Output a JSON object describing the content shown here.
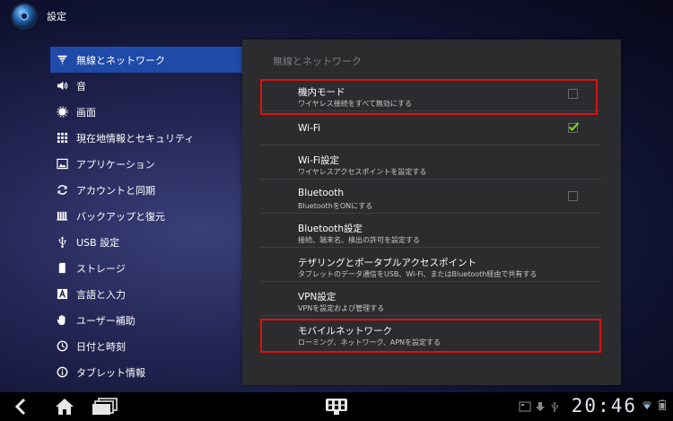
{
  "app": {
    "title": "設定"
  },
  "sidebar": {
    "items": [
      {
        "label": "無線とネットワーク",
        "icon": "wifi-icon",
        "selected": true
      },
      {
        "label": "音",
        "icon": "speaker-icon",
        "selected": false
      },
      {
        "label": "画面",
        "icon": "display-icon",
        "selected": false
      },
      {
        "label": "現在地情報とセキュリティ",
        "icon": "grid-icon",
        "selected": false
      },
      {
        "label": "アプリケーション",
        "icon": "image-icon",
        "selected": false
      },
      {
        "label": "アカウントと同期",
        "icon": "sync-icon",
        "selected": false
      },
      {
        "label": "バックアップと復元",
        "icon": "backup-icon",
        "selected": false
      },
      {
        "label": "USB 設定",
        "icon": "usb-icon",
        "selected": false
      },
      {
        "label": "ストレージ",
        "icon": "sd-card-icon",
        "selected": false
      },
      {
        "label": "言語と入力",
        "icon": "language-icon",
        "selected": false
      },
      {
        "label": "ユーザー補助",
        "icon": "hand-icon",
        "selected": false
      },
      {
        "label": "日付と時刻",
        "icon": "clock-icon",
        "selected": false
      },
      {
        "label": "タブレット情報",
        "icon": "info-icon",
        "selected": false
      }
    ]
  },
  "panel": {
    "header": "無線とネットワーク",
    "rows": [
      {
        "title": "機内モード",
        "summary": "ワイヤレス接続をすべて無効にする",
        "checkbox": "unchecked"
      },
      {
        "title": "Wi-Fi",
        "summary": "",
        "checkbox": "checked"
      },
      {
        "title": "Wi-Fi設定",
        "summary": "ワイヤレスアクセスポイントを設定する",
        "checkbox": "none"
      },
      {
        "title": "Bluetooth",
        "summary": "BluetoothをONにする",
        "checkbox": "unchecked"
      },
      {
        "title": "Bluetooth設定",
        "summary": "接続、端末名、検出の許可を設定する",
        "checkbox": "none"
      },
      {
        "title": "テザリングとポータブルアクセスポイント",
        "summary": "タブレットのデータ通信をUSB、Wi-Fi、またはBluetooth経由で共有する",
        "checkbox": "none"
      },
      {
        "title": "VPN設定",
        "summary": "VPNを設定および管理する",
        "checkbox": "none"
      },
      {
        "title": "モバイルネットワーク",
        "summary": "ローミング、ネットワーク、APNを設定する",
        "checkbox": "none"
      }
    ]
  },
  "navbar": {
    "clock": "20:46"
  },
  "colors": {
    "selected": "#1f4aa8",
    "highlight": "#e01010",
    "checkmark": "#7ad12a"
  }
}
